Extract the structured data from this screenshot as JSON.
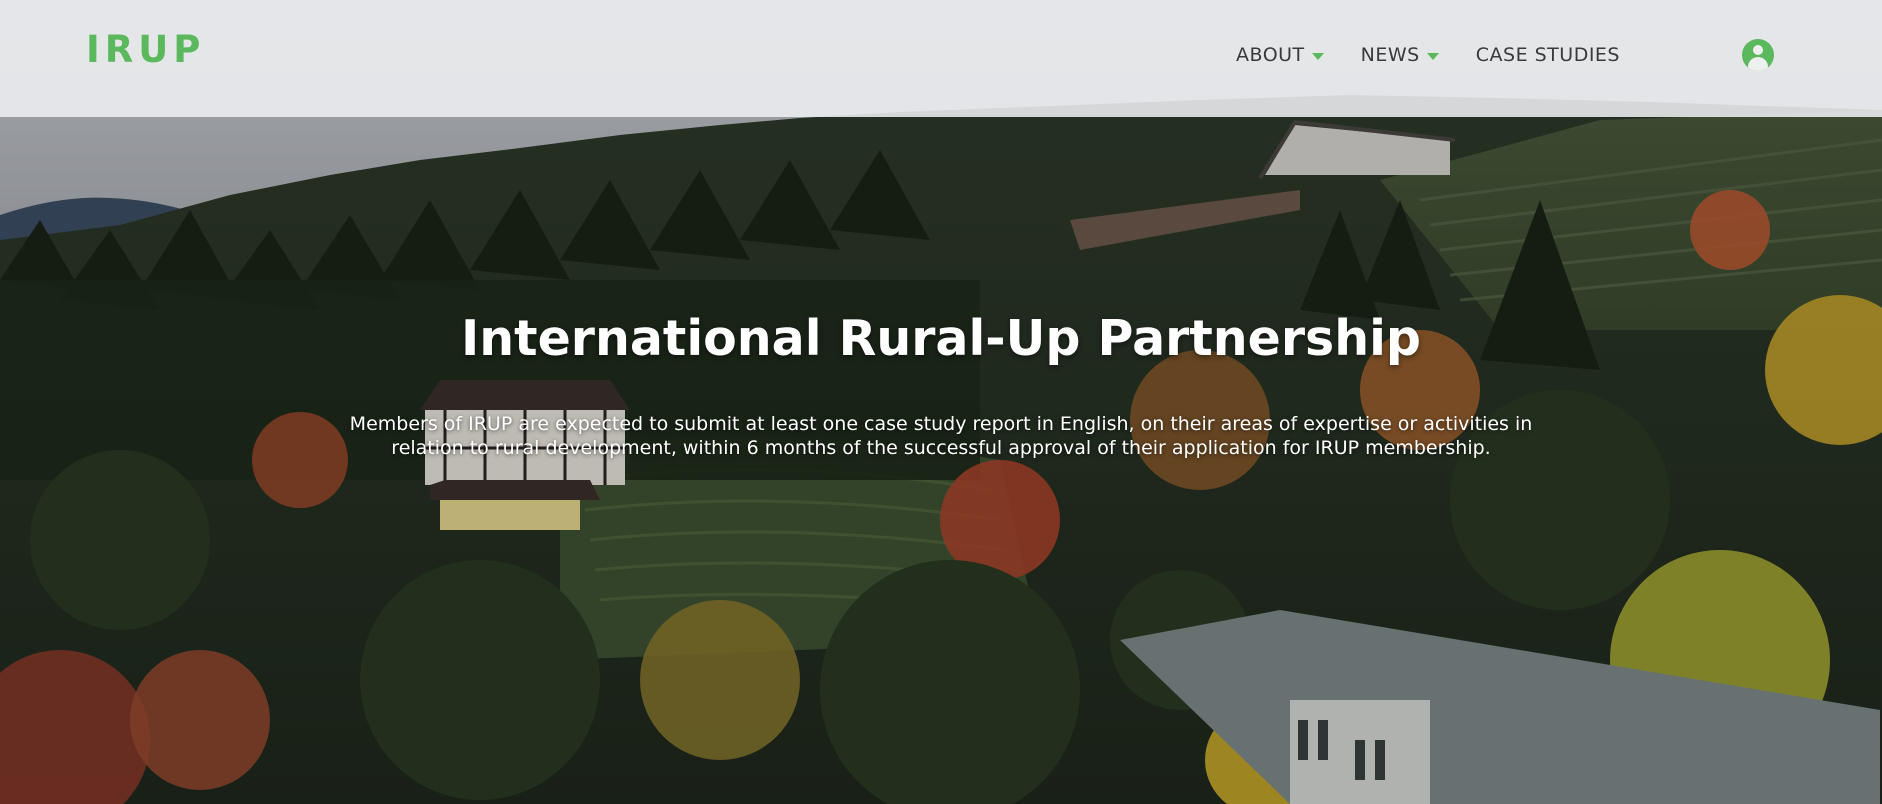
{
  "header": {
    "logo": "IRUP",
    "nav": [
      {
        "label": "ABOUT",
        "has_dropdown": true
      },
      {
        "label": "NEWS",
        "has_dropdown": true
      },
      {
        "label": "CASE STUDIES",
        "has_dropdown": false
      }
    ],
    "user_icon": "user-circle-icon"
  },
  "hero": {
    "title": "International Rural-Up Partnership",
    "subtitle": "Members of IRUP are expected to submit at least one case study report in English, on their areas of expertise or activities in relation to rural development, within 6 months of the successful approval of their application for IRUP membership."
  },
  "colors": {
    "accent": "#5cb85c",
    "nav_text": "#3a3a3a",
    "header_bg": "#eeeff1"
  }
}
